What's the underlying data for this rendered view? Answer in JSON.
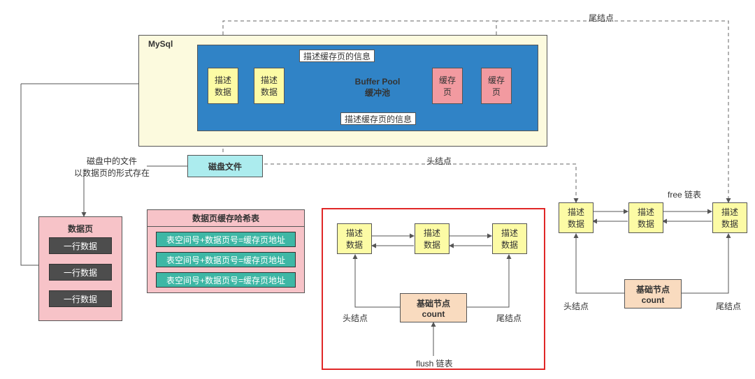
{
  "mysql": {
    "title": "MySql"
  },
  "bufferPool": {
    "title1": "Buffer Pool",
    "title2": "缓冲池"
  },
  "descData": {
    "label": "描述\n数据"
  },
  "cachePage": {
    "label": "缓存\n页"
  },
  "descInfoTop": "描述缓存页的信息",
  "descInfoBottom": "描述缓存页的信息",
  "tailNode": "尾结点",
  "headNode": "头结点",
  "diskFile": "磁盘文件",
  "diskNote": {
    "line1": "磁盘中的文件",
    "line2": "以数据页的形式存在"
  },
  "dataPage": {
    "title": "数据页",
    "row": "一行数据"
  },
  "hashTable": {
    "title": "数据页缓存哈希表",
    "entry": "表空间号+数据页号=缓存页地址"
  },
  "flush": {
    "descData": "描述\n数据",
    "baseNode1": "基础节点",
    "baseNode2": "count",
    "headLabel": "头结点",
    "tailLabel": "尾结点",
    "listLabel": "flush 链表"
  },
  "free": {
    "listLabel": "free 链表",
    "descData": "描述\n数据",
    "baseNode1": "基础节点",
    "baseNode2": "count",
    "headLabel": "头结点",
    "tailLabel": "尾结点"
  }
}
